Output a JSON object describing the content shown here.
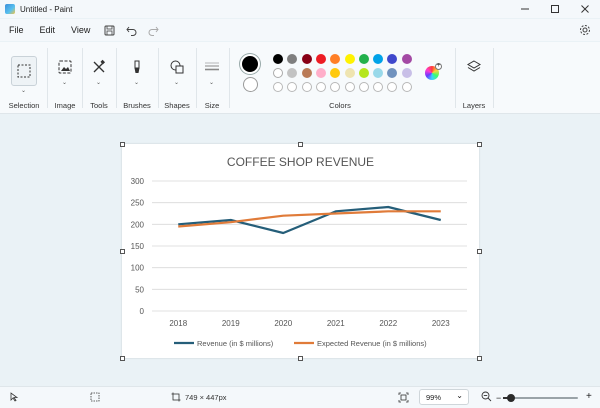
{
  "window": {
    "title": "Untitled - Paint"
  },
  "menu": {
    "file": "File",
    "edit": "Edit",
    "view": "View"
  },
  "ribbon": {
    "groups": {
      "selection": "Selection",
      "image": "Image",
      "tools": "Tools",
      "brushes": "Brushes",
      "shapes": "Shapes",
      "size": "Size",
      "colors": "Colors",
      "layers": "Layers"
    },
    "primary_color": "#000000",
    "secondary_color": "#ffffff",
    "palette_row1": [
      "#000000",
      "#7f7f7f",
      "#880015",
      "#ed1c24",
      "#ff7f27",
      "#fff200",
      "#22b14c",
      "#00a2e8",
      "#3f48cc",
      "#a349a4"
    ],
    "palette_row2": [
      "#ffffff",
      "#c3c3c3",
      "#b97a57",
      "#ffaec9",
      "#ffc90e",
      "#efe4b0",
      "#b5e61d",
      "#99d9ea",
      "#7092be",
      "#c8bfe7"
    ]
  },
  "chart_data": {
    "type": "line",
    "title": "COFFEE SHOP REVENUE",
    "categories": [
      "2018",
      "2019",
      "2020",
      "2021",
      "2022",
      "2023"
    ],
    "yticks": [
      "0",
      "50",
      "100",
      "150",
      "200",
      "250",
      "300"
    ],
    "ylim": [
      0,
      300
    ],
    "grid": true,
    "legend_position": "bottom",
    "series": [
      {
        "name": "Revenue (in $ millions)",
        "color": "#255e79",
        "values": [
          200,
          210,
          180,
          230,
          240,
          210
        ]
      },
      {
        "name": "Expected Revenue (in $ millions)",
        "color": "#e07b39",
        "values": [
          195,
          205,
          220,
          225,
          230,
          230
        ]
      }
    ]
  },
  "status": {
    "canvas_size": "749 × 447px",
    "zoom": "99%",
    "zoom_level": 0.1
  }
}
